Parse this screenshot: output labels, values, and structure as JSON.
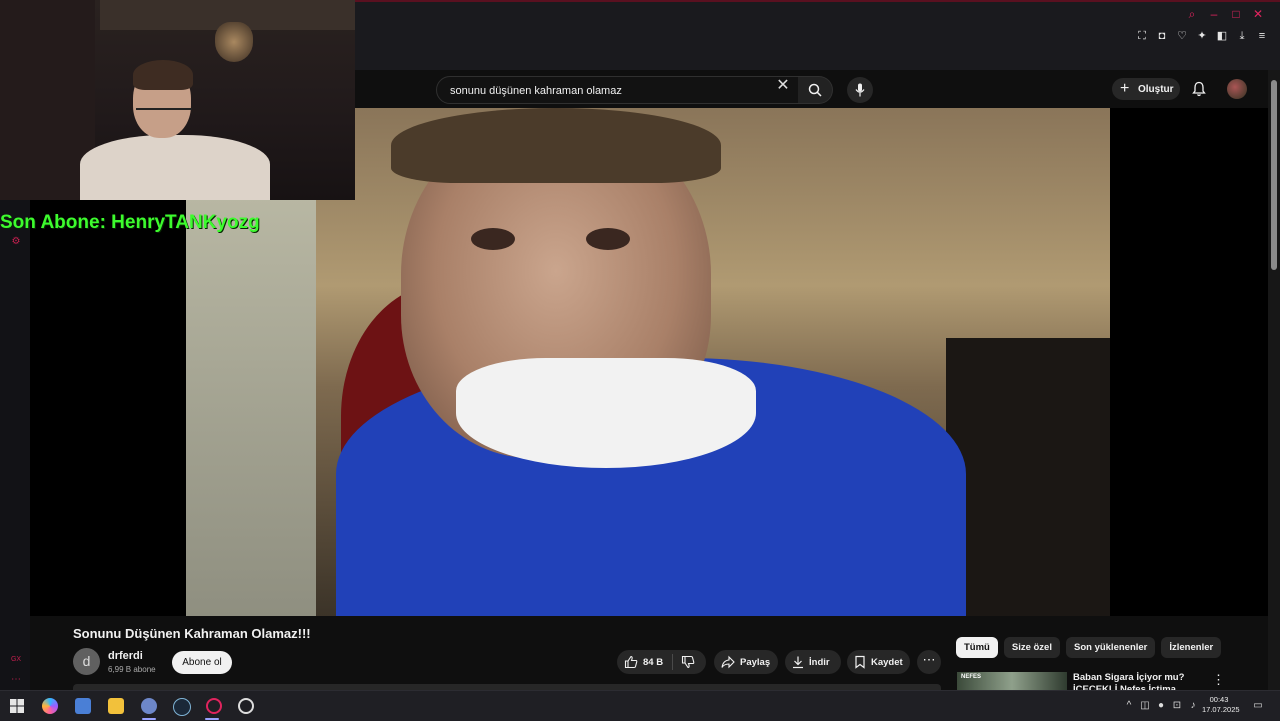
{
  "search": {
    "query": "sonunu düşünen kahraman olamaz"
  },
  "header": {
    "create_label": "Oluştur"
  },
  "stream_overlay": {
    "text": "Son Abone: HenryTANKyozg"
  },
  "video": {
    "title": "Sonunu Düşünen Kahraman Olamaz!!!"
  },
  "channel": {
    "avatar_letter": "d",
    "name": "drferdi",
    "subscribers": "6,99 B abone",
    "subscribe_label": "Abone ol"
  },
  "actions": {
    "likes": "84 B",
    "share_label": "Paylaş",
    "download_label": "İndir",
    "save_label": "Kaydet"
  },
  "filter_chips": [
    "Tümü",
    "Size özel",
    "Son yüklenenler",
    "İzlenenler"
  ],
  "recommendations": [
    {
      "thumb_tag": "NEFES",
      "title": "Baban Sigara İçiyor mu? İÇECEKLİ Nefes İçtima Sahnesi"
    }
  ],
  "taskbar": {
    "time": "00:43",
    "date": "17.07.2025"
  },
  "colors": {
    "overlay_text": "#3dfb2e",
    "browser_accent": "#e0245e",
    "yt_background": "#0f0f0f"
  }
}
